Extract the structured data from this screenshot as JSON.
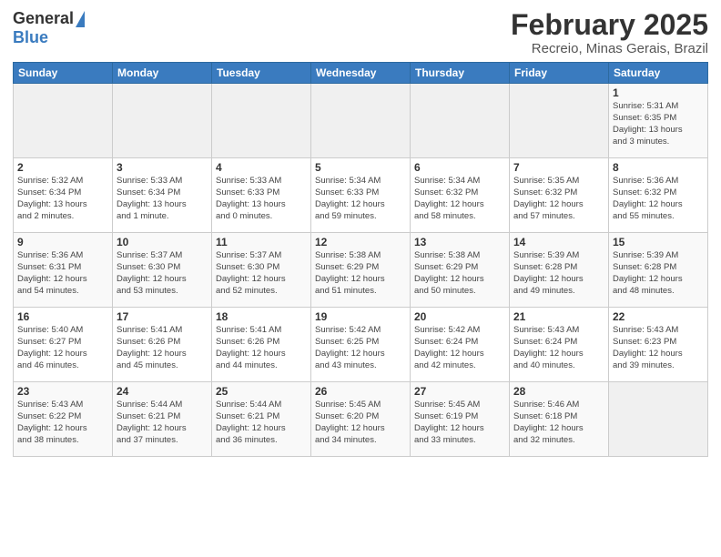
{
  "header": {
    "logo_general": "General",
    "logo_blue": "Blue",
    "main_title": "February 2025",
    "subtitle": "Recreio, Minas Gerais, Brazil"
  },
  "days_of_week": [
    "Sunday",
    "Monday",
    "Tuesday",
    "Wednesday",
    "Thursday",
    "Friday",
    "Saturday"
  ],
  "weeks": [
    [
      {
        "day": "",
        "info": ""
      },
      {
        "day": "",
        "info": ""
      },
      {
        "day": "",
        "info": ""
      },
      {
        "day": "",
        "info": ""
      },
      {
        "day": "",
        "info": ""
      },
      {
        "day": "",
        "info": ""
      },
      {
        "day": "1",
        "info": "Sunrise: 5:31 AM\nSunset: 6:35 PM\nDaylight: 13 hours\nand 3 minutes."
      }
    ],
    [
      {
        "day": "2",
        "info": "Sunrise: 5:32 AM\nSunset: 6:34 PM\nDaylight: 13 hours\nand 2 minutes."
      },
      {
        "day": "3",
        "info": "Sunrise: 5:33 AM\nSunset: 6:34 PM\nDaylight: 13 hours\nand 1 minute."
      },
      {
        "day": "4",
        "info": "Sunrise: 5:33 AM\nSunset: 6:33 PM\nDaylight: 13 hours\nand 0 minutes."
      },
      {
        "day": "5",
        "info": "Sunrise: 5:34 AM\nSunset: 6:33 PM\nDaylight: 12 hours\nand 59 minutes."
      },
      {
        "day": "6",
        "info": "Sunrise: 5:34 AM\nSunset: 6:32 PM\nDaylight: 12 hours\nand 58 minutes."
      },
      {
        "day": "7",
        "info": "Sunrise: 5:35 AM\nSunset: 6:32 PM\nDaylight: 12 hours\nand 57 minutes."
      },
      {
        "day": "8",
        "info": "Sunrise: 5:36 AM\nSunset: 6:32 PM\nDaylight: 12 hours\nand 55 minutes."
      }
    ],
    [
      {
        "day": "9",
        "info": "Sunrise: 5:36 AM\nSunset: 6:31 PM\nDaylight: 12 hours\nand 54 minutes."
      },
      {
        "day": "10",
        "info": "Sunrise: 5:37 AM\nSunset: 6:30 PM\nDaylight: 12 hours\nand 53 minutes."
      },
      {
        "day": "11",
        "info": "Sunrise: 5:37 AM\nSunset: 6:30 PM\nDaylight: 12 hours\nand 52 minutes."
      },
      {
        "day": "12",
        "info": "Sunrise: 5:38 AM\nSunset: 6:29 PM\nDaylight: 12 hours\nand 51 minutes."
      },
      {
        "day": "13",
        "info": "Sunrise: 5:38 AM\nSunset: 6:29 PM\nDaylight: 12 hours\nand 50 minutes."
      },
      {
        "day": "14",
        "info": "Sunrise: 5:39 AM\nSunset: 6:28 PM\nDaylight: 12 hours\nand 49 minutes."
      },
      {
        "day": "15",
        "info": "Sunrise: 5:39 AM\nSunset: 6:28 PM\nDaylight: 12 hours\nand 48 minutes."
      }
    ],
    [
      {
        "day": "16",
        "info": "Sunrise: 5:40 AM\nSunset: 6:27 PM\nDaylight: 12 hours\nand 46 minutes."
      },
      {
        "day": "17",
        "info": "Sunrise: 5:41 AM\nSunset: 6:26 PM\nDaylight: 12 hours\nand 45 minutes."
      },
      {
        "day": "18",
        "info": "Sunrise: 5:41 AM\nSunset: 6:26 PM\nDaylight: 12 hours\nand 44 minutes."
      },
      {
        "day": "19",
        "info": "Sunrise: 5:42 AM\nSunset: 6:25 PM\nDaylight: 12 hours\nand 43 minutes."
      },
      {
        "day": "20",
        "info": "Sunrise: 5:42 AM\nSunset: 6:24 PM\nDaylight: 12 hours\nand 42 minutes."
      },
      {
        "day": "21",
        "info": "Sunrise: 5:43 AM\nSunset: 6:24 PM\nDaylight: 12 hours\nand 40 minutes."
      },
      {
        "day": "22",
        "info": "Sunrise: 5:43 AM\nSunset: 6:23 PM\nDaylight: 12 hours\nand 39 minutes."
      }
    ],
    [
      {
        "day": "23",
        "info": "Sunrise: 5:43 AM\nSunset: 6:22 PM\nDaylight: 12 hours\nand 38 minutes."
      },
      {
        "day": "24",
        "info": "Sunrise: 5:44 AM\nSunset: 6:21 PM\nDaylight: 12 hours\nand 37 minutes."
      },
      {
        "day": "25",
        "info": "Sunrise: 5:44 AM\nSunset: 6:21 PM\nDaylight: 12 hours\nand 36 minutes."
      },
      {
        "day": "26",
        "info": "Sunrise: 5:45 AM\nSunset: 6:20 PM\nDaylight: 12 hours\nand 34 minutes."
      },
      {
        "day": "27",
        "info": "Sunrise: 5:45 AM\nSunset: 6:19 PM\nDaylight: 12 hours\nand 33 minutes."
      },
      {
        "day": "28",
        "info": "Sunrise: 5:46 AM\nSunset: 6:18 PM\nDaylight: 12 hours\nand 32 minutes."
      },
      {
        "day": "",
        "info": ""
      }
    ]
  ]
}
